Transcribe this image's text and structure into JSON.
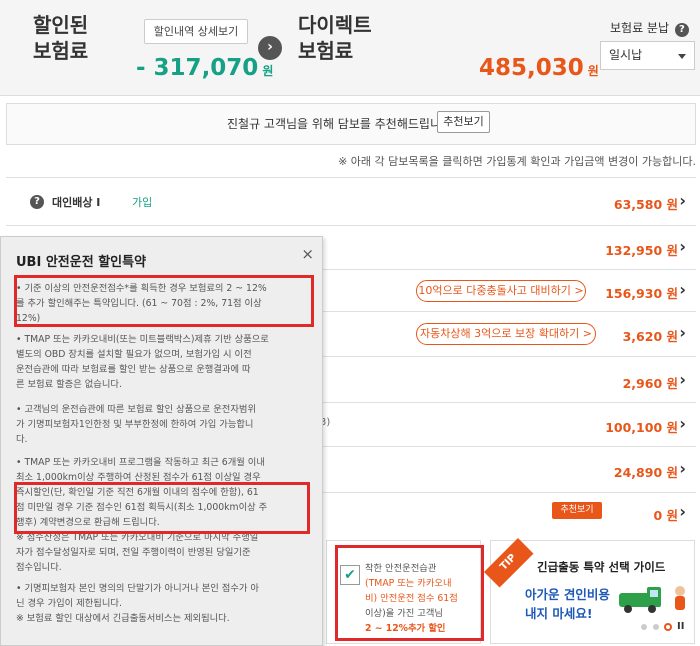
{
  "header": {
    "discount_label_line1": "할인된",
    "discount_label_line2": "보험료",
    "detail_button": "할인내역 상세보기",
    "discount_amount": "- 317,070",
    "won": "원",
    "direct_label_line1": "다이렉트",
    "direct_label_line2": "보험료",
    "direct_amount": "485,030",
    "payment_label": "보험료 분납",
    "payment_selected": "일시납"
  },
  "recommend": {
    "text": "진철규 고객님을 위해 담보를 추천해드립니다.",
    "button": "추천보기"
  },
  "note": "※ 아래 각 담보목록을 클릭하면 가입통계 확인과 가입금액 변경이 가능합니다.",
  "coverage": [
    {
      "name": "대인배상 I",
      "status": "가입",
      "price": "63,580 원"
    },
    {
      "price": "132,950 원"
    },
    {
      "pill": "10억으로 다중충돌사고 대비하기 >",
      "price": "156,930 원"
    },
    {
      "pill": "자동차상해 3억으로 보장 확대하기 >",
      "price": "3,620 원"
    },
    {
      "price": "2,960 원"
    },
    {
      "fragment": "3)",
      "price": "100,100 원"
    },
    {
      "price": "24,890 원"
    },
    {
      "pill": "추천보기",
      "price": "0 원"
    }
  ],
  "popup": {
    "title": "UBI 안전운전 할인특약",
    "close": "×",
    "paragraphs": [
      [
        "• 기준 이상의 안전운전점수*를 획득한 경우 보험료의 2 ~ 12%",
        "  를 추가 할인해주는 특약입니다. (61 ~ 70점 : 2%, 71점 이상",
        "  12%)"
      ],
      [
        "• TMAP 또는 카카오내비(또는 미트블랙박스)제휴 기반 상품으로",
        "  별도의 OBD 장치를 설치할 필요가 없으며, 보험가입 시 이전",
        "  운전습관에 따라 보험료를 할인 받는 상품으로 운행결과에 따",
        "  른 보험료 할증은 없습니다."
      ],
      [
        "• 고객님의 운전습관에 따른 보험료 할인 상품으로 운전자범위",
        "  가 기명피보험자1인한정 및 부부한정에 한하여 가입 가능합니",
        "  다."
      ],
      [
        "• TMAP 또는 카카오내비 프로그램을 작동하고 최근 6개월 이내",
        "  최소 1,000km이상 주행하여 산정된 점수가 61점 이상일 경우",
        "  즉시할인(단, 확인일 기준 직전 6개월 이내의 점수에 한함), 61",
        "  점 미만일 경우 기준 점수인 61점 획득시(최소 1,000km이상 주",
        "  행후) 계약변경으로 환급해 드립니다.",
        "  ※ 점수산정은 TMAP 또는 카카오내비 기준으로 마지막 주행일",
        "  자가 점수달성일자로 되며, 전일 주행이력이 반영된 당일기준",
        "  점수입니다."
      ],
      [
        "• 기명피보험자 본인 명의의 단말기가 아니거나 본인 점수가 아",
        "  닌 경우 가입이 제한됩니다.",
        "  ※ 보험료 할인 대상에서 긴급출동서비스는 제외됩니다."
      ]
    ]
  },
  "ubi_checkbox": {
    "lines": [
      "착한 안전운전습관",
      "(TMAP 또는 카카오내",
      "비) 안전운전 점수 61점",
      "이상)을 가진 고객님",
      "2 ~ 12%추가 할인"
    ]
  },
  "guide": {
    "tip": "TIP",
    "title": "긴급출동 특약 선택 가이드",
    "promo_line1": "아가운 견인비용",
    "promo_line2": "내지 마세요!"
  },
  "colors": {
    "accent": "#e8561a",
    "green": "#16a085",
    "highlight": "#e02a2a"
  }
}
